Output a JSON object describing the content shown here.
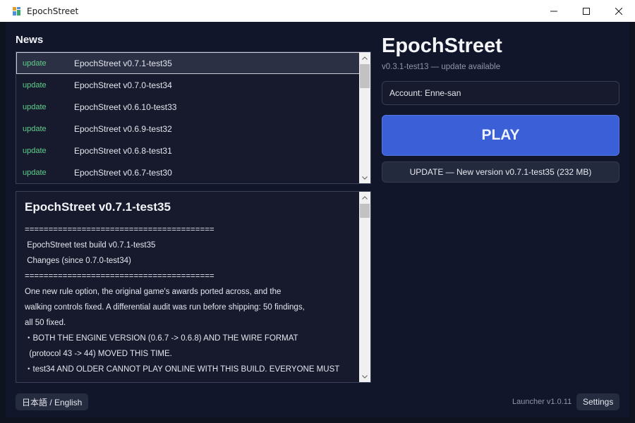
{
  "window": {
    "title": "EpochStreet"
  },
  "news": {
    "heading": "News",
    "items": [
      {
        "tag": "update",
        "title": "EpochStreet v0.7.1-test35"
      },
      {
        "tag": "update",
        "title": "EpochStreet v0.7.0-test34"
      },
      {
        "tag": "update",
        "title": "EpochStreet v0.6.10-test33"
      },
      {
        "tag": "update",
        "title": "EpochStreet v0.6.9-test32"
      },
      {
        "tag": "update",
        "title": "EpochStreet v0.6.8-test31"
      },
      {
        "tag": "update",
        "title": "EpochStreet v0.6.7-test30"
      }
    ],
    "selected_index": 0
  },
  "article": {
    "title": "EpochStreet v0.7.1-test35",
    "lines": [
      "========================================",
      " EpochStreet test build v0.7.1-test35",
      " Changes (since 0.7.0-test34)",
      "========================================",
      "One new rule option, the original game's awards ported across, and the",
      "walking controls fixed. A differential audit was run before shipping: 50 findings,",
      "all 50 fixed.",
      "・BOTH THE ENGINE VERSION (0.6.7 -> 0.6.8) AND THE WIRE FORMAT",
      "  (protocol 43 -> 44) MOVED THIS TIME.",
      "・test34 AND OLDER CANNOT PLAY ONLINE WITH THIS BUILD. EVERYONE MUST"
    ]
  },
  "panel": {
    "brand": "EpochStreet",
    "version": "v0.3.1-test13 — update available",
    "account": "Account: Enne-san",
    "play_label": "PLAY",
    "update_label": "UPDATE — New version v0.7.1-test35 (232 MB)"
  },
  "footer": {
    "language_label": "日本語 / English",
    "launcher_version": "Launcher v1.0.11",
    "settings_label": "Settings"
  },
  "colors": {
    "accent": "#3a5fd6",
    "tag": "#5fcf8a",
    "background": "#12162a"
  }
}
